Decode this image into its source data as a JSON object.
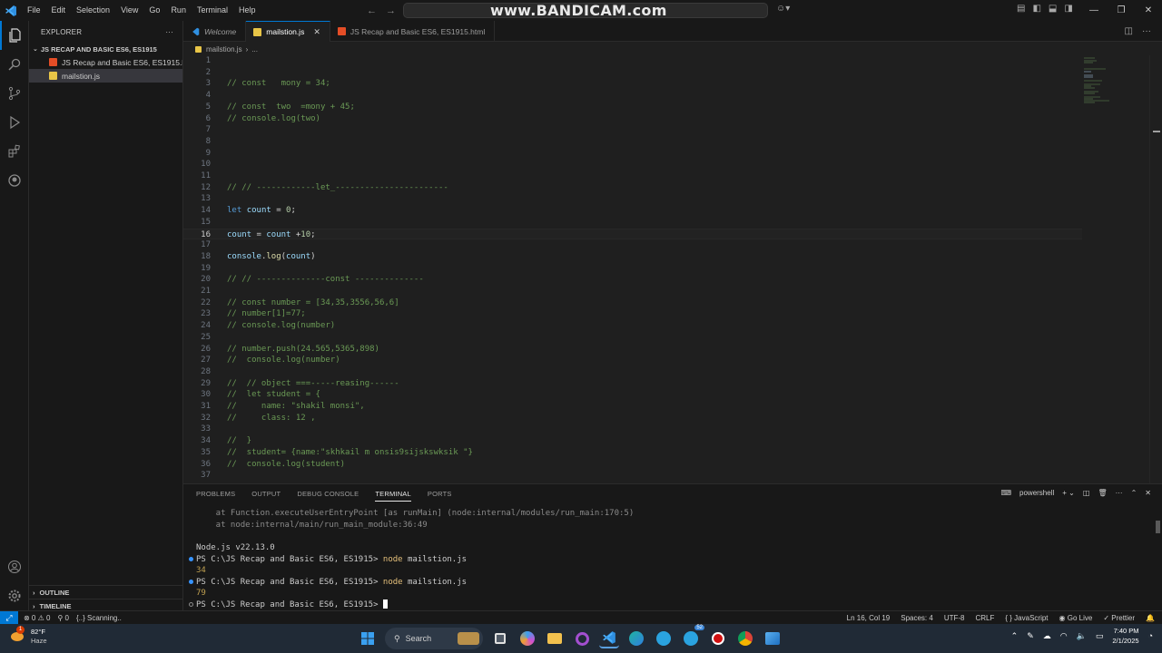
{
  "menu": [
    "File",
    "Edit",
    "Selection",
    "View",
    "Go",
    "Run",
    "Terminal",
    "Help"
  ],
  "watermark": "www.BANDICAM.com",
  "sidebar": {
    "title": "EXPLORER",
    "folder": "JS RECAP AND BASIC ES6, ES1915",
    "files": [
      {
        "name": "JS Recap and Basic ES6, ES1915.h...",
        "type": "html"
      },
      {
        "name": "mailstion.js",
        "type": "js"
      }
    ],
    "outline": "OUTLINE",
    "timeline": "TIMELINE"
  },
  "tabs": [
    {
      "label": "Welcome",
      "type": "vscode"
    },
    {
      "label": "mailstion.js",
      "type": "js"
    },
    {
      "label": "JS Recap and Basic ES6, ES1915.html",
      "type": "html"
    }
  ],
  "breadcrumb": {
    "file": "mailstion.js",
    "rest": "..."
  },
  "editor": {
    "current_line": 16,
    "lines": [
      {
        "n": "1",
        "t": ""
      },
      {
        "n": "2",
        "t": ""
      },
      {
        "n": "3",
        "t": "// const   mony = 34;"
      },
      {
        "n": "4",
        "t": ""
      },
      {
        "n": "5",
        "t": "// const  two  =mony + 45;"
      },
      {
        "n": "6",
        "t": "// console.log(two)"
      },
      {
        "n": "7",
        "t": ""
      },
      {
        "n": "8",
        "t": ""
      },
      {
        "n": "9",
        "t": ""
      },
      {
        "n": "10",
        "t": ""
      },
      {
        "n": "11",
        "t": ""
      },
      {
        "n": "12",
        "t": "// // ------------let_-----------------------"
      },
      {
        "n": "13",
        "t": ""
      },
      {
        "n": "14",
        "t": "let count = 0;"
      },
      {
        "n": "15",
        "t": ""
      },
      {
        "n": "16",
        "t": "count = count +10;"
      },
      {
        "n": "17",
        "t": ""
      },
      {
        "n": "18",
        "t": "console.log(count)"
      },
      {
        "n": "19",
        "t": ""
      },
      {
        "n": "20",
        "t": "// // --------------const --------------"
      },
      {
        "n": "21",
        "t": ""
      },
      {
        "n": "22",
        "t": "// const number = [34,35,3556,56,6]"
      },
      {
        "n": "23",
        "t": "// number[1]=77;"
      },
      {
        "n": "24",
        "t": "// console.log(number)"
      },
      {
        "n": "25",
        "t": ""
      },
      {
        "n": "26",
        "t": "// number.push(24.565,5365,898)"
      },
      {
        "n": "27",
        "t": "//  console.log(number)"
      },
      {
        "n": "28",
        "t": ""
      },
      {
        "n": "29",
        "t": "//  // object ===-----reasing------"
      },
      {
        "n": "30",
        "t": "//  let student = {"
      },
      {
        "n": "31",
        "t": "//     name: \"shakil monsi\","
      },
      {
        "n": "32",
        "t": "//     class: 12 ,"
      },
      {
        "n": "33",
        "t": ""
      },
      {
        "n": "34",
        "t": "//  }"
      },
      {
        "n": "35",
        "t": "//  student= {name:\"skhkail m onsis9sijskswksik \"}"
      },
      {
        "n": "36",
        "t": "//  console.log(student)"
      },
      {
        "n": "37",
        "t": ""
      }
    ]
  },
  "panel": {
    "tabs": [
      "PROBLEMS",
      "OUTPUT",
      "DEBUG CONSOLE",
      "TERMINAL",
      "PORTS"
    ],
    "active_tab": "TERMINAL",
    "shell": "powershell",
    "terminal": {
      "trace1": "    at Function.executeUserEntryPoint [as runMain] (node:internal/modules/run_main:170:5)",
      "trace2": "    at node:internal/main/run_main_module:36:49",
      "node_version": "Node.js v22.13.0",
      "prompt": "PS C:\\JS Recap and Basic ES6, ES1915> ",
      "cmd_node": "node",
      "cmd_file": " mailstion.js",
      "out1": "34",
      "out2": "79"
    }
  },
  "statusbar": {
    "problems": "⊗ 0  ⚠ 0",
    "ports": "⚲ 0",
    "scanning": "{..} Scanning..",
    "position": "Ln 16, Col 19",
    "spaces": "Spaces: 4",
    "encoding": "UTF-8",
    "eol": "CRLF",
    "language": "{ } JavaScript",
    "golive": "Go Live",
    "prettier": "✓ Prettier"
  },
  "taskbar": {
    "temp": "82°F",
    "condition": "Haze",
    "weather_badge": "1",
    "search": "Search",
    "telegram_badge": "52",
    "time": "7:40 PM",
    "date": "2/1/2025"
  },
  "colors": {
    "accent": "#0078d4",
    "comment": "#6a9955",
    "keyword": "#569cd6",
    "variable": "#9cdcfe",
    "number": "#b5cea8",
    "function": "#dcdcaa"
  }
}
